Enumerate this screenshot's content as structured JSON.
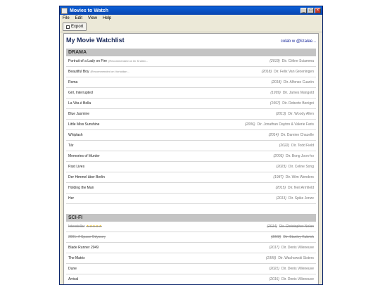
{
  "window": {
    "title": "Movies to Watch"
  },
  "menu": [
    "File",
    "Edit",
    "View",
    "Help"
  ],
  "toolbar": {
    "export_label": "Export"
  },
  "header": {
    "title": "My Movie Watchlist",
    "user": "colab w @lizalee..."
  },
  "sections": [
    {
      "name": "DRAMA",
      "movies": [
        {
          "title": "Portrait of a Lady on Fire",
          "note": "(Recommended on ler Kruliev...",
          "year": "(2019)",
          "director": "Dir. Céline Sciamma",
          "watched": false
        },
        {
          "title": "Beautiful Boy",
          "note": "(Recommended on Vortuldan...",
          "year": "(2018)",
          "director": "Dir. Felix Van Groeningen",
          "watched": false
        },
        {
          "title": "Roma",
          "note": "",
          "year": "(2018)",
          "director": "Dir. Alfonso Cuarón",
          "watched": false
        },
        {
          "title": "Girl, Interrupted",
          "note": "",
          "year": "(1999)",
          "director": "Dir. James Mangold",
          "watched": false
        },
        {
          "title": "La Vita è Bella",
          "note": "",
          "year": "(1997)",
          "director": "Dir. Roberto Benigni",
          "watched": false
        },
        {
          "title": "Blue Jasmine",
          "note": "",
          "year": "(2013)",
          "director": "Dir. Woody Allen",
          "watched": false
        },
        {
          "title": "Little Miss Sunshine",
          "note": "",
          "year": "(2006)",
          "director": "Dir. Jonathan Dayton & Valerie Faris",
          "watched": false
        },
        {
          "title": "Whiplash",
          "note": "",
          "year": "(2014)",
          "director": "Dir. Damien Chazelle",
          "watched": false
        },
        {
          "title": "Tár",
          "note": "",
          "year": "(2022)",
          "director": "Dir. Todd Field",
          "watched": false
        },
        {
          "title": "Memories of Murder",
          "note": "",
          "year": "(2003)",
          "director": "Dir. Bong Joon-ho",
          "watched": false
        },
        {
          "title": "Past Lives",
          "note": "",
          "year": "(2023)",
          "director": "Dir. Celine Song",
          "watched": false
        },
        {
          "title": "Der Himmel über Berlin",
          "note": "",
          "year": "(1987)",
          "director": "Dir. Wim Wenders",
          "watched": false
        },
        {
          "title": "Holding the Man",
          "note": "",
          "year": "(2015)",
          "director": "Dir. Neil Armfield",
          "watched": false
        },
        {
          "title": "Her",
          "note": "",
          "year": "(2013)",
          "director": "Dir. Spike Jonze",
          "watched": false
        }
      ]
    },
    {
      "name": "SCI-FI",
      "movies": [
        {
          "title": "Interstellar",
          "note": "",
          "stars": "★★★★★",
          "year": "(2014)",
          "director": "Dir. Christopher Nolan",
          "watched": true
        },
        {
          "title": "2001: A Space Odyssey",
          "note": "",
          "year": "(1968)",
          "director": "Dir. Stanley Kubrick",
          "watched": true
        },
        {
          "title": "Blade Runner 2049",
          "note": "",
          "year": "(2017)",
          "director": "Dir. Denis Villeneuve",
          "watched": false
        },
        {
          "title": "The Matrix",
          "note": "",
          "year": "(1999)",
          "director": "Dir. Wachowski Sisters",
          "watched": false
        },
        {
          "title": "Dune",
          "note": "",
          "year": "(2021)",
          "director": "Dir. Denis Villeneuve",
          "watched": false
        },
        {
          "title": "Arrival",
          "note": "",
          "year": "(2016)",
          "director": "Dir. Denis Villeneuve",
          "watched": false
        }
      ]
    }
  ]
}
